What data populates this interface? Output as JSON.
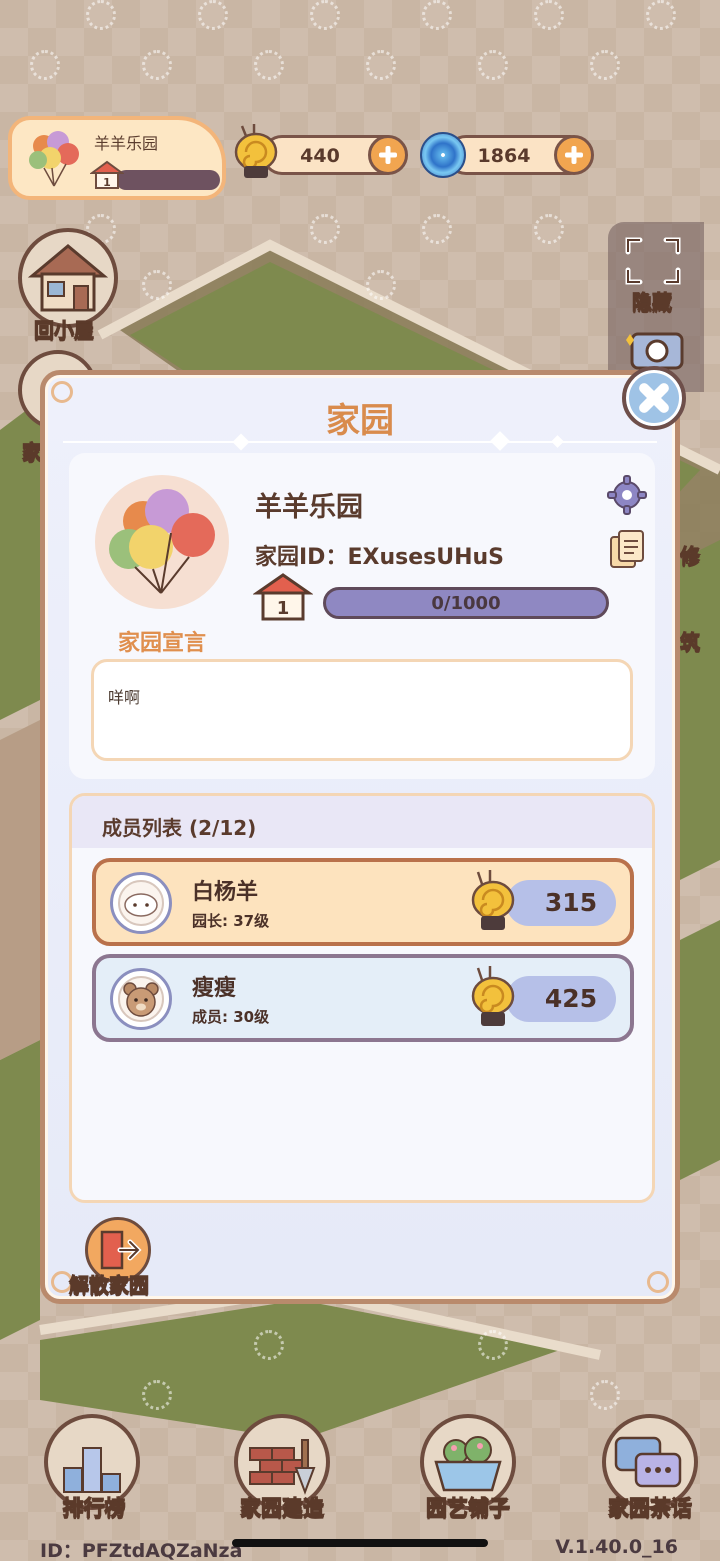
{
  "hud": {
    "garden_name": "羊羊乐园",
    "garden_level": "1",
    "coins": "440",
    "gems": "1864"
  },
  "side": {
    "back_home": "回小屋",
    "left_partial": "家",
    "hide": "隐藏",
    "right_partial_1": "修",
    "right_partial_2": "筑"
  },
  "modal": {
    "title": "家园",
    "garden_name": "羊羊乐园",
    "garden_id": "家园ID：EXusesUHuS",
    "level": "1",
    "exp": "0/1000",
    "manifesto_label": "家园宣言",
    "manifesto_text": "咩啊",
    "members_title": "成员列表 (2/12)",
    "members": [
      {
        "name": "白杨羊",
        "role": "园长: 37级",
        "score": "315"
      },
      {
        "name": "瘦瘦",
        "role": "成员: 30级",
        "score": "425"
      }
    ],
    "disband": "解散家园"
  },
  "bottom": {
    "ranking": "排行榜",
    "build": "家园建造",
    "shop": "园艺铺子",
    "tea": "家园茶话",
    "player_id": "ID：PFZtdAQZaNza",
    "version": "V.1.40.0_16"
  },
  "colors": {
    "accent_orange": "#e08f4e",
    "brown_text": "#5a3b2d",
    "exp_bar": "#8f88c2"
  }
}
